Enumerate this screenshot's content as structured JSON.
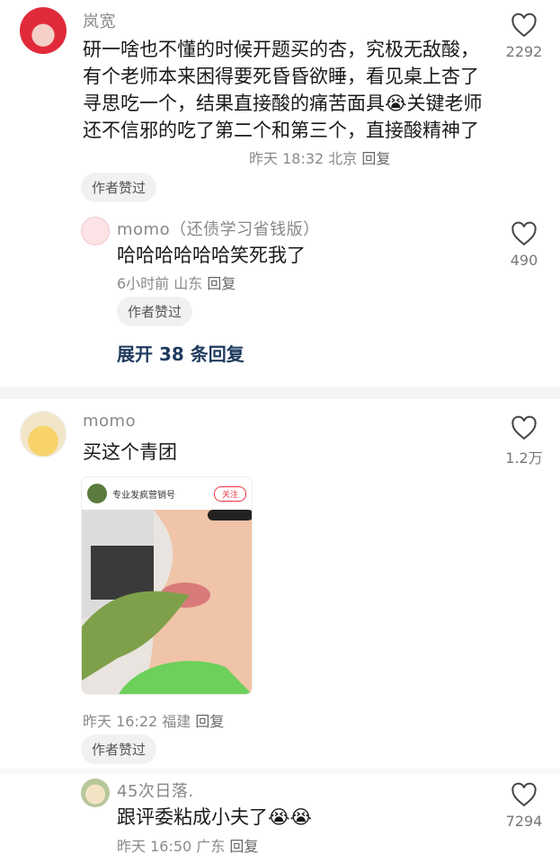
{
  "comments": [
    {
      "name": "岚宽",
      "text": "研一啥也不懂的时候开题买的杏，究极无敌酸，有个老师本来困得要死昏昏欲睡，看见桌上杏了寻思吃一个，结果直接酸的痛苦面具😭关键老师还不信邪的吃了第二个和第三个，直接酸精神了",
      "time": "昨天 18:32",
      "location": "北京",
      "reply": "回复",
      "badge": "作者赞过",
      "likes": "2292",
      "replies": [
        {
          "name": "momo（还债学习省钱版）",
          "text": "哈哈哈哈哈哈笑死我了",
          "time": "6小时前",
          "location": "山东",
          "reply": "回复",
          "badge": "作者赞过",
          "likes": "490"
        }
      ],
      "expand": "展开 38 条回复"
    },
    {
      "name": "momo",
      "text": "买这个青团",
      "embed": {
        "account": "专业发疯营销号",
        "follow": "关注"
      },
      "time": "昨天 16:22",
      "location": "福建",
      "reply": "回复",
      "badge": "作者赞过",
      "likes": "1.2万",
      "replies": [
        {
          "name": "45次日落.",
          "text": "跟评委粘成小夫了😭😭",
          "time": "昨天 16:50",
          "location": "广东",
          "reply": "回复",
          "likes": "7294"
        }
      ]
    }
  ],
  "icons": {
    "like": "heart-outline-icon"
  }
}
